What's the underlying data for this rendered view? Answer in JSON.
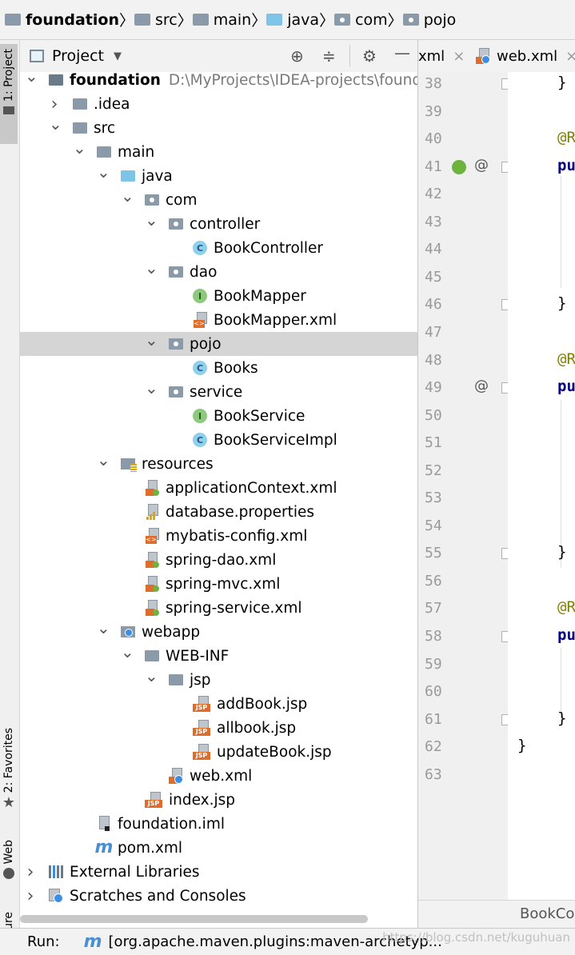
{
  "breadcrumb": [
    "foundation",
    "src",
    "main",
    "java",
    "com",
    "pojo"
  ],
  "stripe": {
    "project": "1: Project",
    "favorites": "2: Favorites",
    "web": "Web",
    "structure": "ructure"
  },
  "project_panel": {
    "title": "Project"
  },
  "tree": [
    {
      "label": "foundation",
      "hint": "D:\\MyProjects\\IDEA-projects\\foundati",
      "arrow": "down",
      "icon": "module-folder-icon",
      "bold": true
    },
    {
      "label": ".idea",
      "arrow": "right",
      "icon": "folder-icon"
    },
    {
      "label": "src",
      "arrow": "down",
      "icon": "folder-icon"
    },
    {
      "label": "main",
      "arrow": "down",
      "icon": "folder-icon"
    },
    {
      "label": "java",
      "arrow": "down",
      "icon": "source-folder-icon"
    },
    {
      "label": "com",
      "arrow": "down",
      "icon": "package-icon"
    },
    {
      "label": "controller",
      "arrow": "down",
      "icon": "package-icon"
    },
    {
      "label": "BookController",
      "arrow": "none",
      "icon": "class-icon"
    },
    {
      "label": "dao",
      "arrow": "down",
      "icon": "package-icon"
    },
    {
      "label": "BookMapper",
      "arrow": "none",
      "icon": "interface-icon"
    },
    {
      "label": "BookMapper.xml",
      "arrow": "none",
      "icon": "xml-file-icon"
    },
    {
      "label": "pojo",
      "arrow": "down",
      "icon": "package-icon",
      "selected": true
    },
    {
      "label": "Books",
      "arrow": "none",
      "icon": "class-icon"
    },
    {
      "label": "service",
      "arrow": "down",
      "icon": "package-icon"
    },
    {
      "label": "BookService",
      "arrow": "none",
      "icon": "interface-icon"
    },
    {
      "label": "BookServiceImpl",
      "arrow": "none",
      "icon": "class-icon"
    },
    {
      "label": "resources",
      "arrow": "down",
      "icon": "resources-folder-icon"
    },
    {
      "label": "applicationContext.xml",
      "arrow": "none",
      "icon": "spring-xml-icon"
    },
    {
      "label": "database.properties",
      "arrow": "none",
      "icon": "properties-file-icon"
    },
    {
      "label": "mybatis-config.xml",
      "arrow": "none",
      "icon": "xml-file-icon"
    },
    {
      "label": "spring-dao.xml",
      "arrow": "none",
      "icon": "spring-xml-icon"
    },
    {
      "label": "spring-mvc.xml",
      "arrow": "none",
      "icon": "spring-xml-icon"
    },
    {
      "label": "spring-service.xml",
      "arrow": "none",
      "icon": "spring-xml-icon"
    },
    {
      "label": "webapp",
      "arrow": "down",
      "icon": "web-folder-icon"
    },
    {
      "label": "WEB-INF",
      "arrow": "down",
      "icon": "folder-icon"
    },
    {
      "label": "jsp",
      "arrow": "down",
      "icon": "folder-icon"
    },
    {
      "label": "addBook.jsp",
      "arrow": "none",
      "icon": "jsp-file-icon"
    },
    {
      "label": "allbook.jsp",
      "arrow": "none",
      "icon": "jsp-file-icon"
    },
    {
      "label": "updateBook.jsp",
      "arrow": "none",
      "icon": "jsp-file-icon"
    },
    {
      "label": "web.xml",
      "arrow": "none",
      "icon": "web-xml-icon"
    },
    {
      "label": "index.jsp",
      "arrow": "none",
      "icon": "jsp-file-icon"
    },
    {
      "label": "foundation.iml",
      "arrow": "none",
      "icon": "iml-file-icon"
    },
    {
      "label": "pom.xml",
      "arrow": "none",
      "icon": "maven-icon"
    },
    {
      "label": "External Libraries",
      "arrow": "right",
      "icon": "libraries-icon"
    },
    {
      "label": "Scratches and Consoles",
      "arrow": "right",
      "icon": "scratches-icon"
    }
  ],
  "editor_tabs": [
    {
      "label": "xml",
      "close": "×"
    },
    {
      "label": "web.xml",
      "close": "×"
    }
  ],
  "gutter_lines": [
    "38",
    "39",
    "40",
    "41",
    "42",
    "43",
    "44",
    "45",
    "46",
    "47",
    "48",
    "49",
    "50",
    "51",
    "52",
    "53",
    "54",
    "55",
    "56",
    "57",
    "58",
    "59",
    "60",
    "61",
    "62",
    "63"
  ],
  "code": {
    "l38": "}",
    "l40": "@R",
    "l41": "pu",
    "l46": "}",
    "l48": "@R",
    "l49": "pu",
    "l55": "}",
    "l57": "@R",
    "l58": "pu",
    "l61": "}",
    "l62": "}"
  },
  "gutter_marks": {
    "at": "@"
  },
  "editor_bottom": "BookCor",
  "run_bar": {
    "label": "Run:",
    "config": "[org.apache.maven.plugins:maven-archetyp..."
  },
  "watermark": "https://blog.csdn.net/kuguhuan",
  "colors": {
    "annotation": "#808000",
    "keyword": "#000080",
    "selection": "#d5d5d5",
    "current_line": "#fcfae8"
  }
}
